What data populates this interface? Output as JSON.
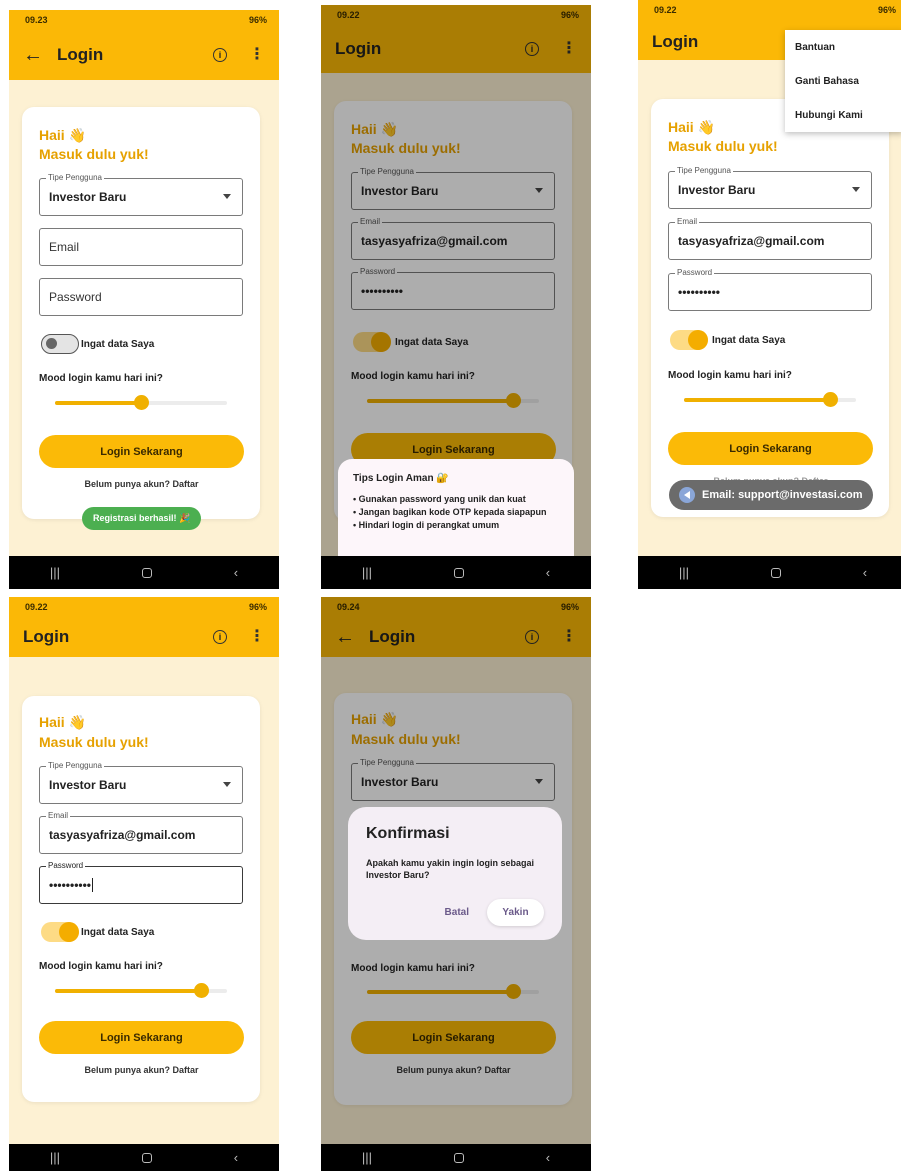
{
  "screens": [
    {
      "status_time": "09.23",
      "status_right": "96%",
      "title": "Login",
      "greeting": "Haii 👋",
      "subtitle": "Masuk dulu yuk!",
      "user_type_label": "Tipe Pengguna",
      "user_type_value": "Investor Baru",
      "email_placeholder": "Email",
      "password_placeholder": "Password",
      "remember_label": "Ingat data Saya",
      "mood_label": "Mood login kamu hari ini?",
      "mood_value": 0.5,
      "login_button": "Login Sekarang",
      "signup_link": "Belum punya akun? Daftar",
      "toast": "Registrasi berhasil! 🎉"
    },
    {
      "status_time": "09.22",
      "status_right": "96%",
      "title": "Login",
      "greeting": "Haii 👋",
      "subtitle": "Masuk dulu yuk!",
      "user_type_label": "Tipe Pengguna",
      "user_type_value": "Investor Baru",
      "email_label": "Email",
      "email_value": "tasyasyafriza@gmail.com",
      "password_label": "Password",
      "password_value": "••••••••••",
      "remember_label": "Ingat data Saya",
      "mood_label": "Mood login kamu hari ini?",
      "mood_value": 0.85,
      "login_button": "Login Sekarang",
      "sheet_title": "Tips Login Aman 🔐",
      "tips": [
        "• Gunakan password yang unik dan kuat",
        "• Jangan bagikan kode OTP kepada siapapun",
        "• Hindari login di perangkat umum"
      ]
    },
    {
      "status_time": "09.22",
      "status_right": "96%",
      "title": "Login",
      "menu_items": [
        "Bantuan",
        "Ganti Bahasa",
        "Hubungi Kami"
      ],
      "greeting": "Haii 👋",
      "subtitle": "Masuk dulu yuk!",
      "user_type_label": "Tipe Pengguna",
      "user_type_value": "Investor Baru",
      "email_label": "Email",
      "email_value": "tasyasyafriza@gmail.com",
      "password_label": "Password",
      "password_value": "••••••••••",
      "remember_label": "Ingat data Saya",
      "mood_label": "Mood login kamu hari ini?",
      "mood_value": 0.85,
      "login_button": "Login Sekarang",
      "signup_link": "Belum punya akun? Daftar",
      "toast": "Email: support@investasi.com"
    },
    {
      "status_time": "09.22",
      "status_right": "96%",
      "title": "Login",
      "greeting": "Haii 👋",
      "subtitle": "Masuk dulu yuk!",
      "user_type_label": "Tipe Pengguna",
      "user_type_value": "Investor Baru",
      "email_label": "Email",
      "email_value": "tasyasyafriza@gmail.com",
      "password_label": "Password",
      "password_value": "••••••••••",
      "remember_label": "Ingat data Saya",
      "mood_label": "Mood login kamu hari ini?",
      "mood_value": 0.85,
      "login_button": "Login Sekarang",
      "signup_link": "Belum punya akun? Daftar"
    },
    {
      "status_time": "09.24",
      "status_right": "96%",
      "title": "Login",
      "greeting": "Haii 👋",
      "subtitle": "Masuk dulu yuk!",
      "user_type_label": "Tipe Pengguna",
      "user_type_value": "Investor Baru",
      "mood_label": "Mood login kamu hari ini?",
      "mood_value": 0.85,
      "login_button": "Login Sekarang",
      "signup_link": "Belum punya akun? Daftar",
      "dialog_title": "Konfirmasi",
      "dialog_message": "Apakah kamu yakin ingin login sebagai Investor Baru?",
      "dialog_cancel": "Batal",
      "dialog_confirm": "Yakin"
    }
  ],
  "colors": {
    "primary": "#fbb806",
    "background": "#fdf1d3",
    "accent_text": "#e6a100",
    "toast_success": "#4caf50"
  },
  "icons": [
    "back-arrow-icon",
    "info-icon",
    "more-vert-icon",
    "dropdown-caret-icon",
    "flutter-logo-icon"
  ]
}
